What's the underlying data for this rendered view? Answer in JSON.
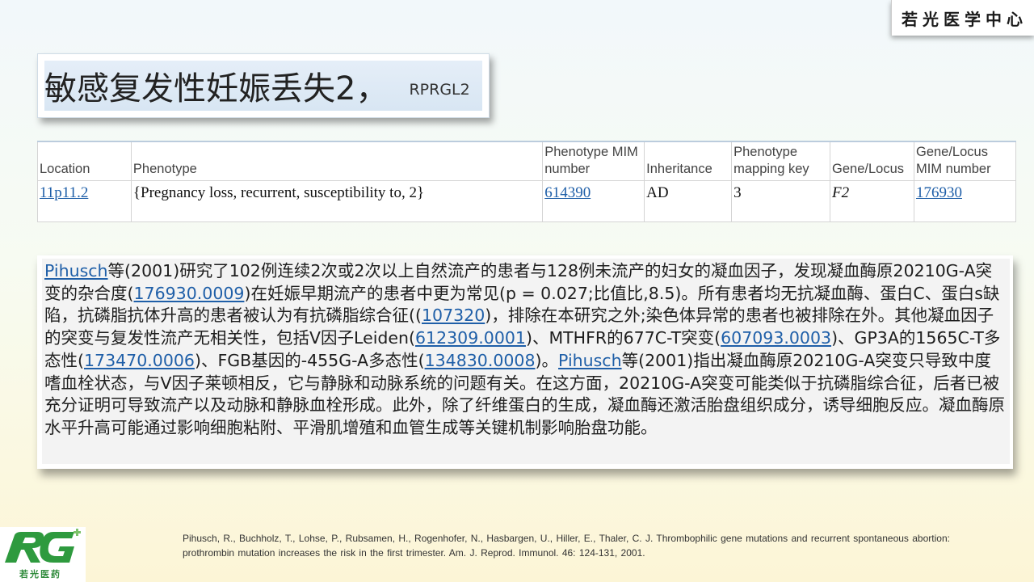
{
  "brand": {
    "name": "若光医学中心"
  },
  "title": {
    "main": "敏感复发性妊娠丢失2，",
    "sub": "RPRGL2"
  },
  "table": {
    "headers": [
      {
        "label": "Location"
      },
      {
        "label": "Phenotype"
      },
      {
        "label": "Phenotype MIM number"
      },
      {
        "label": "Inheritance"
      },
      {
        "label": "Phenotype mapping key"
      },
      {
        "label": "Gene/Locus"
      },
      {
        "label": "Gene/Locus MIM number"
      }
    ],
    "row": {
      "location": "11p11.2",
      "phenotype": "{Pregnancy loss, recurrent, susceptibility to, 2}",
      "phenotype_mim": "614390",
      "inheritance": "AD",
      "mapping_key": "3",
      "gene": "F2",
      "gene_mim": "176930"
    }
  },
  "body": {
    "link_pihusch": "Pihusch",
    "t1": "等(2001)研究了102例连续2次或2次以上自然流产的患者与128例未流产的妇女的凝血因子，发现凝血酶原20210G-A突变的杂合度(",
    "link_176930": "176930.0009",
    "t2": ")在妊娠早期流产的患者中更为常见(p = 0.027;比值比,8.5)。所有患者均无抗凝血酶、蛋白C、蛋白s缺陷，抗磷脂抗体升高的患者被认为有抗磷脂综合征((",
    "link_107320": "107320",
    "t3": ")，排除在本研究之外;染色体异常的患者也被排除在外。其他凝血因子的突变与复发性流产无相关性，包括V因子Leiden(",
    "link_612309": "612309.0001",
    "t4": ")、MTHFR的677C-T突变(",
    "link_607093": "607093.0003",
    "t5": ")、GP3A的1565C-T多态性(",
    "link_173470": "173470.0006",
    "t6": ")、FGB基因的-455G-A多态性(",
    "link_134830": "134830.0008",
    "t7": ")。",
    "t8": "等(2001)指出凝血酶原20210G-A突变只导致中度嗜血栓状态，与V因子莱顿相反，它与静脉和动脉系统的问题有关。在这方面，20210G-A突变可能类似于抗磷脂综合征，后者已被充分证明可导致流产以及动脉和静脉血栓形成。此外，除了纤维蛋白的生成，凝血酶还激活胎盘组织成分，诱导细胞反应。凝血酶原水平升高可能通过影响细胞粘附、平滑肌增殖和血管生成等关键机制影响胎盘功能。"
  },
  "reference": "Pihusch, R., Buchholz, T., Lohse, P., Rubsamen, H., Rogenhofer, N., Hasbargen, U., Hiller, E., Thaler, C. J. Thrombophilic gene mutations and recurrent spontaneous abortion: prothrombin mutation increases the risk in the first trimester. Am. J. Reprod. Immunol. 46: 124-131, 2001.",
  "logo": {
    "caption": "若光医药",
    "mark_color": "#2e9a3e"
  }
}
